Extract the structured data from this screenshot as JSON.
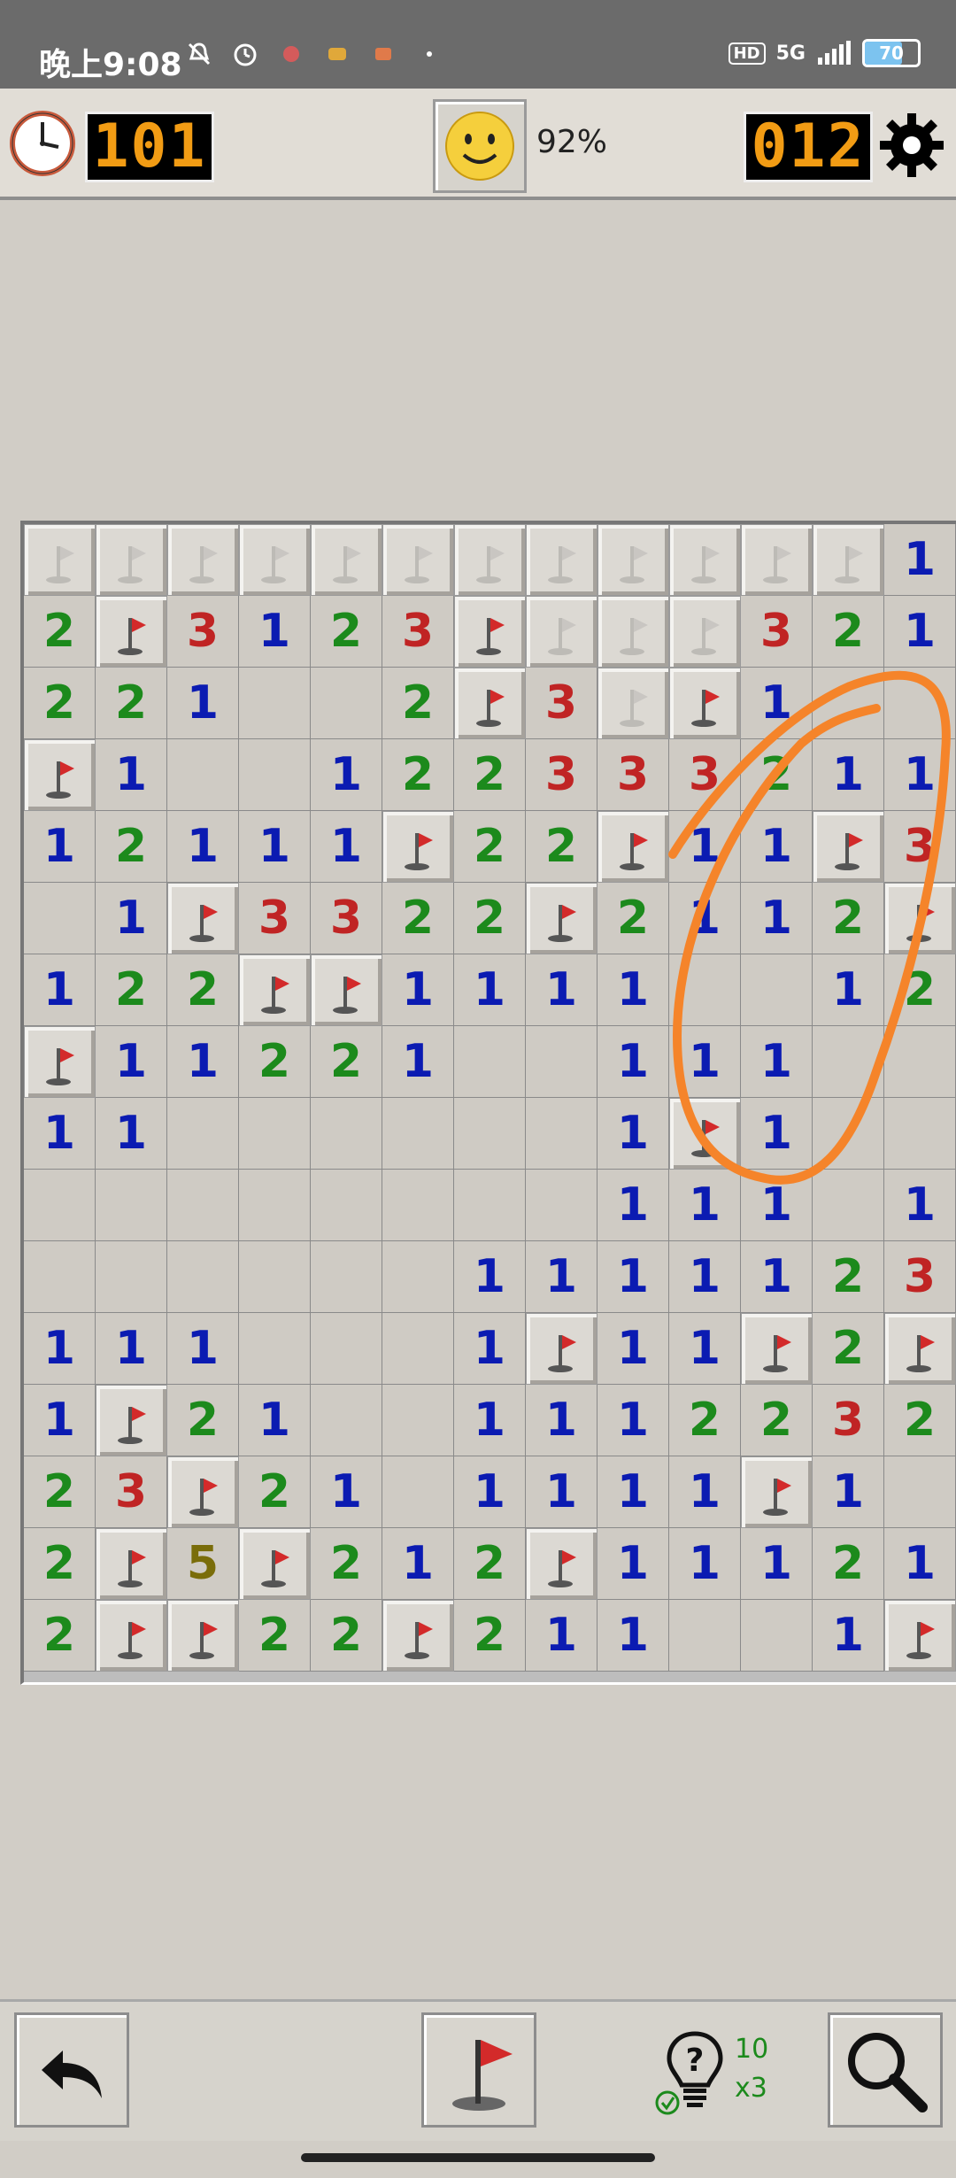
{
  "status_bar": {
    "time": "晚上9:08",
    "icons": [
      "mute-icon",
      "alarm-icon",
      "app-icon",
      "app-icon",
      "app-icon",
      "dot-icon"
    ],
    "hd": "HD",
    "network": "5G",
    "battery": "70",
    "battery_level": 0.7
  },
  "header": {
    "timer": "101",
    "percent": "92%",
    "mines_left": "012"
  },
  "board": {
    "rows": 16,
    "cols": 13,
    "legend": "F = flagged tile, G = covered tile with faint flag mark, . = revealed empty, digit = revealed number",
    "grid": [
      "GGGGGGGGGGGG1",
      "2F3123FGGG321",
      "221..2F3GF1..",
      "F1..12233321 1",
      "1211 1F22F11F3",
      ".1F3322F2112F",
      "122FF1111..12",
      "F11221..111..",
      "11......1F1..",
      "........111.1",
      "......1111123",
      "111...1F11F2F",
      "1F21..1112232",
      "23F21.1111F1.",
      "2F5F212F11121",
      "2FF22F211..1F"
    ]
  },
  "colors": {
    "one": "#0b1bb2",
    "two": "#1c8a1c",
    "three": "#c02424",
    "five": "#7a6d0a",
    "lcd_digits": "#f29c14",
    "annotation": "#f5842a"
  },
  "footer": {
    "hint_count": "10",
    "hint_multiplier": "x3",
    "undo_icon": "undo-arrow-icon",
    "flag_icon": "flag-mode-icon",
    "hint_icon": "lightbulb-hint-icon",
    "zoom_icon": "magnifier-icon"
  }
}
